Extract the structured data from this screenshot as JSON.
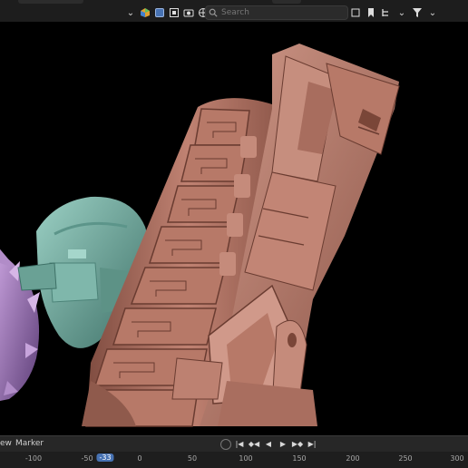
{
  "header": {
    "search_placeholder": "Search",
    "icons": [
      "chevron-down-icon",
      "collection-color-icon",
      "checkbox-icon",
      "view-icon",
      "camera-icon",
      "globe-icon",
      "image-icon",
      "search-icon",
      "filter-icon"
    ]
  },
  "viewport": {
    "description_colors": {
      "main_model": "#b77968",
      "teal_model": "#6fa89c",
      "purple_model": "#9a76b3"
    }
  },
  "timeline": {
    "menus": [
      "ew",
      "Marker"
    ],
    "current_frame": "-33",
    "ticks": [
      "-100",
      "-50",
      "0",
      "50",
      "100",
      "150",
      "200",
      "250",
      "300"
    ],
    "accent": "#4772b3"
  }
}
